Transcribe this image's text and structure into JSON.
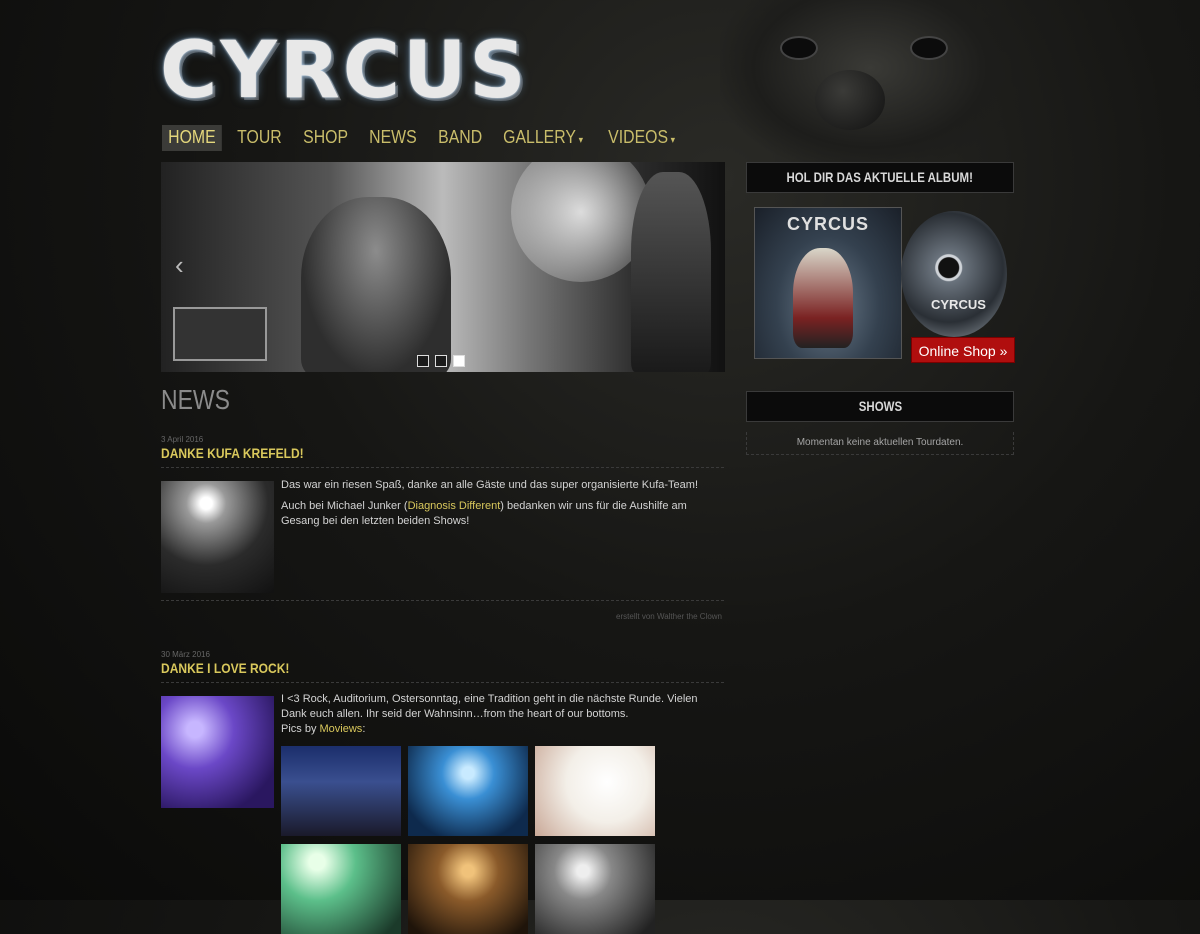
{
  "site": {
    "logo_text": "CYRCUS"
  },
  "nav": {
    "items": [
      {
        "label": "HOME",
        "active": true,
        "has_dropdown": false
      },
      {
        "label": "TOUR",
        "active": false,
        "has_dropdown": false
      },
      {
        "label": "SHOP",
        "active": false,
        "has_dropdown": false
      },
      {
        "label": "NEWS",
        "active": false,
        "has_dropdown": false
      },
      {
        "label": "BAND",
        "active": false,
        "has_dropdown": false
      },
      {
        "label": "GALLERY",
        "active": false,
        "has_dropdown": true
      },
      {
        "label": "VIDEOS",
        "active": false,
        "has_dropdown": true
      }
    ]
  },
  "slider": {
    "prev_icon": "‹",
    "slide_count": 3,
    "active_slide": 3
  },
  "news": {
    "section_title": "NEWS",
    "posts": [
      {
        "date": "3 April 2016",
        "title": "DANKE KUFA KREFELD!",
        "paragraph1": "Das war ein riesen Spaß, danke an alle Gäste und das super organisierte Kufa-Team!",
        "paragraph2_before": "Auch bei Michael Junker (",
        "paragraph2_link": "Diagnosis Different",
        "paragraph2_after": ") bedanken wir uns für die Aushilfe am Gesang bei den letzten beiden Shows!",
        "byline": "erstellt von Walther the Clown"
      },
      {
        "date": "30 März 2016",
        "title": "DANKE I LOVE ROCK!",
        "paragraph1": "I <3 Rock, Auditorium, Ostersonntag, eine Tradition geht in die nächste Runde. Vielen Dank euch allen. Ihr seid der Wahnsinn…from the heart of our bottoms.",
        "pics_by_label": "Pics by ",
        "pics_by_link": "Moviews",
        "pics_by_suffix": ":"
      }
    ]
  },
  "sidebar": {
    "album": {
      "heading": "HOL DIR DAS AKTUELLE ALBUM!",
      "cover_title": "CYRCUS",
      "cd_title": "CYRCUS",
      "shop_button": "Online Shop »"
    },
    "shows": {
      "heading": "SHOWS",
      "empty_text": "Momentan keine aktuellen Tourdaten."
    }
  },
  "colors": {
    "accent": "#d9c85c",
    "shop_button": "#b00e0e",
    "nav_active_bg": "#3b3b38"
  }
}
